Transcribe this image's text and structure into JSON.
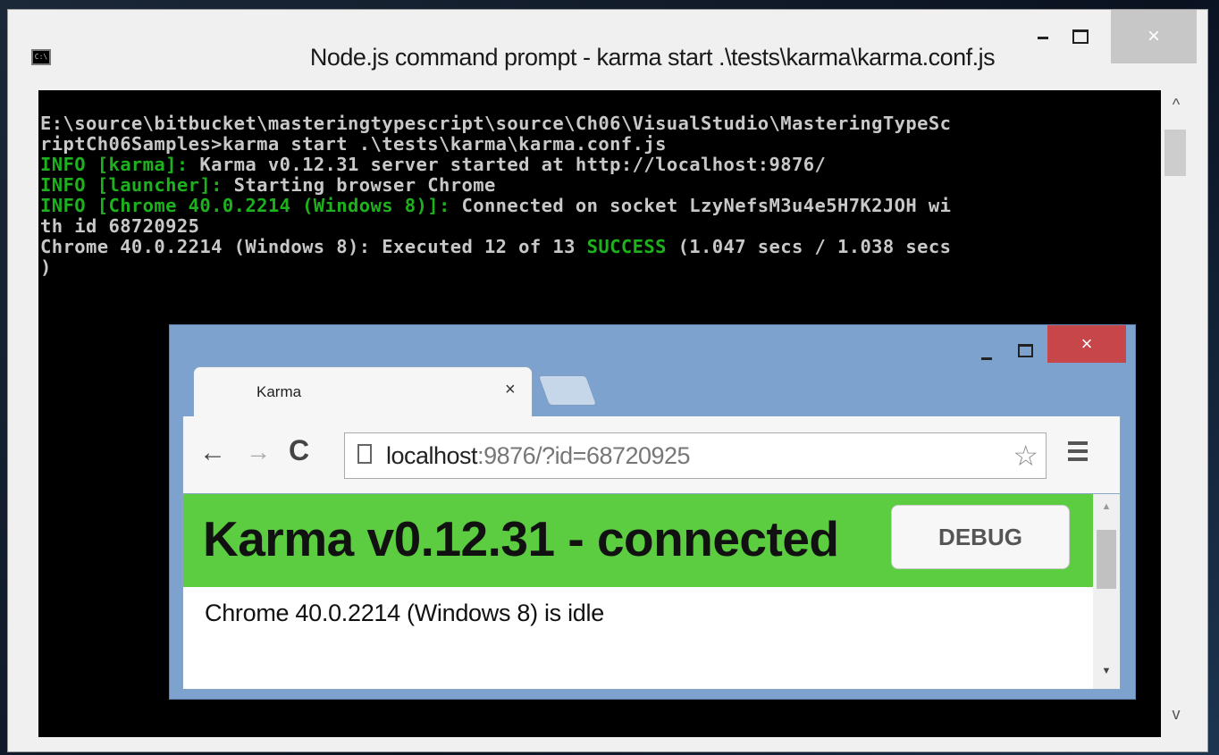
{
  "cmd": {
    "title": "Node.js command prompt - karma  start .\\tests\\karma\\karma.conf.js",
    "icon_label": "C:\\",
    "controls": {
      "minimize": "–",
      "maximize": "□",
      "close": "×"
    },
    "lines": [
      [
        {
          "t": "E:\\source\\bitbucket\\masteringtypescript\\source\\Ch06\\VisualStudio\\MasteringTypeSc",
          "c": ""
        }
      ],
      [
        {
          "t": "riptCh06Samples>karma start .\\tests\\karma\\karma.conf.js",
          "c": ""
        }
      ],
      [
        {
          "t": "INFO [karma]:",
          "c": "g"
        },
        {
          "t": " Karma v0.12.31 server started at http://localhost:9876/",
          "c": ""
        }
      ],
      [
        {
          "t": "INFO [launcher]:",
          "c": "g"
        },
        {
          "t": " Starting browser Chrome",
          "c": ""
        }
      ],
      [
        {
          "t": "INFO [Chrome 40.0.2214 (Windows 8)]:",
          "c": "g"
        },
        {
          "t": " Connected on socket LzyNefsM3u4e5H7K2JOH wi",
          "c": ""
        }
      ],
      [
        {
          "t": "th id 68720925",
          "c": ""
        }
      ],
      [
        {
          "t": "Chrome 40.0.2214 (Windows 8): Executed 12 of 13 ",
          "c": ""
        },
        {
          "t": "SUCCESS",
          "c": "g"
        },
        {
          "t": " (1.047 secs / 1.038 secs",
          "c": ""
        }
      ],
      [
        {
          "t": ")",
          "c": ""
        }
      ]
    ]
  },
  "browser": {
    "controls": {
      "minimize": "–",
      "maximize": "□",
      "close": "×"
    },
    "tab": {
      "title": "Karma",
      "close": "×"
    },
    "nav": {
      "back": "←",
      "forward": "→",
      "reload": "C"
    },
    "url_host": "localhost",
    "url_rest": ":9876/?id=68720925",
    "star": "☆",
    "page": {
      "banner_title": "Karma v0.12.31 - connected",
      "debug_label": "DEBUG",
      "status": "Chrome 40.0.2214 (Windows 8) is idle",
      "banner_color": "#5ccc40"
    }
  }
}
